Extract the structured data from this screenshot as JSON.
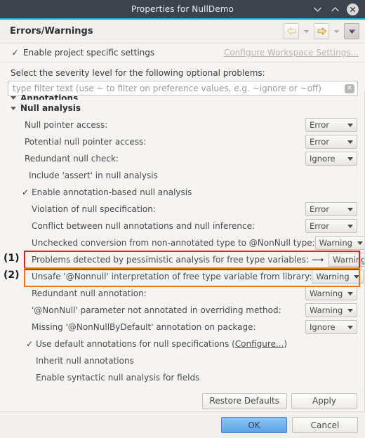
{
  "window": {
    "title": "Properties for NullDemo",
    "controls": [
      {
        "name": "minimize-button",
        "icon": "chevron-down-icon"
      },
      {
        "name": "maximize-button",
        "icon": "chevron-up-icon"
      },
      {
        "name": "close-button",
        "icon": "close-icon"
      }
    ]
  },
  "header": {
    "title": "Errors/Warnings",
    "nav": {
      "back": "back-arrow-icon",
      "back_menu": "chevron-down-icon",
      "forward": "forward-arrow-icon",
      "forward_menu": "chevron-down-icon",
      "view_menu": "filled-triangle-icon"
    }
  },
  "enable_row": {
    "checkmark": "✓",
    "label": "Enable project specific settings",
    "workspace_link": "Configure Workspace Settings..."
  },
  "select_note": "Select the severity level for the following optional problems:",
  "filter": {
    "placeholder": "type filter text (use ~ to filter on preference values, e.g. ~ignore or ~off)",
    "value": "",
    "clear_icon": "✕"
  },
  "groups": [
    {
      "label": "Annotations",
      "expanded": false,
      "clipped": true
    },
    {
      "label": "Null analysis",
      "expanded": true,
      "clipped": false
    }
  ],
  "rows": [
    {
      "label": "Null pointer access:",
      "value": "Error",
      "type": "combo",
      "indent": 1
    },
    {
      "label": "Potential null pointer access:",
      "value": "Error",
      "type": "combo",
      "indent": 1
    },
    {
      "label": "Redundant null check:",
      "value": "Ignore",
      "type": "combo",
      "indent": 1
    },
    {
      "label": "Include 'assert' in null analysis",
      "type": "check",
      "checked": false,
      "indent": 2
    },
    {
      "label": "Enable annotation-based null analysis",
      "type": "check",
      "checked": true,
      "indent": 1
    },
    {
      "label": "Violation of null specification:",
      "value": "Error",
      "type": "combo",
      "indent": 2
    },
    {
      "label": "Conflict between null annotations and null inference:",
      "value": "Error",
      "type": "combo",
      "indent": 2
    },
    {
      "label": "Unchecked conversion from non-annotated type to @NonNull type:",
      "value": "Warning",
      "type": "combo",
      "indent": 2
    },
    {
      "label": "Problems detected by pessimistic analysis for free type variables:",
      "value": "Warning",
      "type": "combo",
      "indent": 2,
      "annotation": "1",
      "highlight": "red",
      "arrow": "⟶"
    },
    {
      "label": "Unsafe '@Nonnull' interpretation of free type variable from library:",
      "value": "Warning",
      "type": "combo",
      "indent": 2,
      "annotation": "2",
      "highlight": "orange"
    },
    {
      "label": "Redundant null annotation:",
      "value": "Warning",
      "type": "combo",
      "indent": 2
    },
    {
      "label": "'@NonNull' parameter not annotated in overriding method:",
      "value": "Warning",
      "type": "combo",
      "indent": 2
    },
    {
      "label": "Missing '@NonNullByDefault' annotation on package:",
      "value": "Ignore",
      "type": "combo",
      "indent": 2
    },
    {
      "label": "Use default annotations for null specifications (",
      "type": "check-link",
      "checked": true,
      "link": "Configure...",
      "label_suffix": ")",
      "indent": 2
    },
    {
      "label": "Inherit null annotations",
      "type": "check",
      "checked": false,
      "indent": 3
    },
    {
      "label": "Enable syntactic null analysis for fields",
      "type": "check",
      "checked": false,
      "indent": 3
    }
  ],
  "apply_bar": {
    "restore_defaults": "Restore Defaults",
    "apply": "Apply"
  },
  "footer": {
    "ok": "OK",
    "cancel": "Cancel"
  },
  "colors": {
    "titlebar": "#3c434d",
    "accent": "#2aa8e0",
    "highlight_red": "#e8201a",
    "highlight_orange": "#ef7316",
    "primary_button": "#5ba3e8",
    "link": "#2a6fb5"
  }
}
